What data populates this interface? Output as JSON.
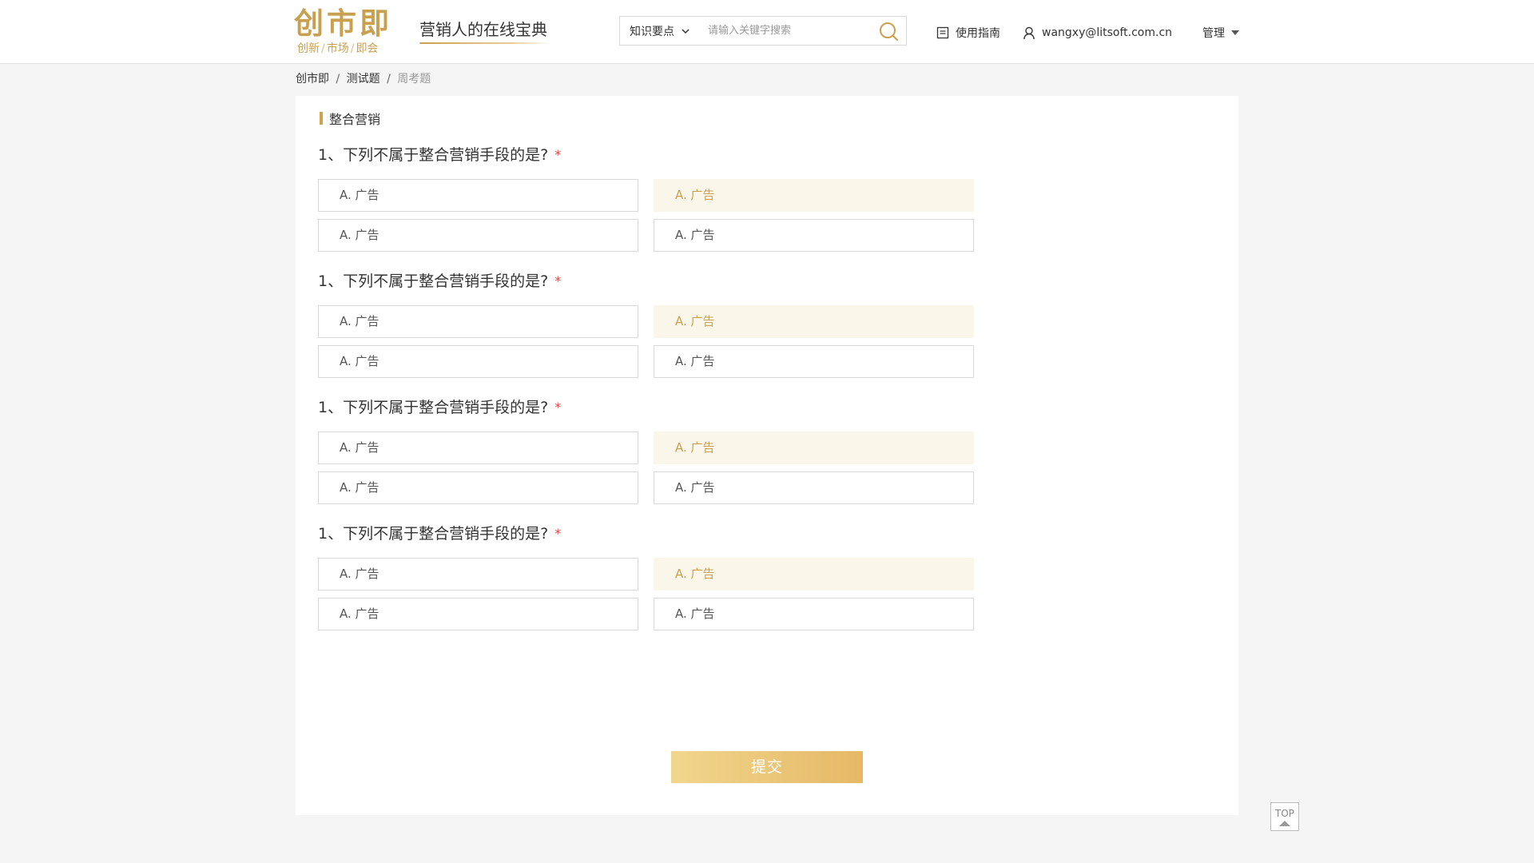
{
  "header": {
    "logo_main": "创市即",
    "logo_sub": [
      "创新",
      "市场",
      "即会"
    ],
    "logo_sep": "/",
    "slogan": "营销人的在线宝典",
    "search": {
      "category": "知识要点",
      "placeholder": "请输入关键字搜索",
      "value": ""
    },
    "guide_label": "使用指南",
    "user_email": "wangxy@litsoft.com.cn",
    "manage_label": "管理"
  },
  "breadcrumb": {
    "items": [
      "创市即",
      "测试题"
    ],
    "current": "周考题",
    "sep": "/"
  },
  "section": {
    "title": "整合营销"
  },
  "questions": [
    {
      "title": "1、下列不属于整合营销手段的是?",
      "required_mark": "*",
      "options": [
        "A. 广告",
        "A. 广告",
        "A. 广告",
        "A. 广告"
      ],
      "selected_index": 1
    },
    {
      "title": "1、下列不属于整合营销手段的是?",
      "required_mark": "*",
      "options": [
        "A. 广告",
        "A. 广告",
        "A. 广告",
        "A. 广告"
      ],
      "selected_index": 1
    },
    {
      "title": "1、下列不属于整合营销手段的是?",
      "required_mark": "*",
      "options": [
        "A. 广告",
        "A. 广告",
        "A. 广告",
        "A. 广告"
      ],
      "selected_index": 1
    },
    {
      "title": "1、下列不属于整合营销手段的是?",
      "required_mark": "*",
      "options": [
        "A. 广告",
        "A. 广告",
        "A. 广告",
        "A. 广告"
      ],
      "selected_index": 1
    }
  ],
  "submit_label": "提交",
  "top_label": "TOP",
  "colors": {
    "accent": "#c9a04f",
    "selected_bg": "#fbf6ea",
    "required": "#e84040"
  },
  "icons": {
    "search": "search-icon",
    "guide": "document-icon",
    "user": "user-icon",
    "select": "chevron-down-icon",
    "manage": "caret-down-icon",
    "top": "arrow-up-icon"
  }
}
